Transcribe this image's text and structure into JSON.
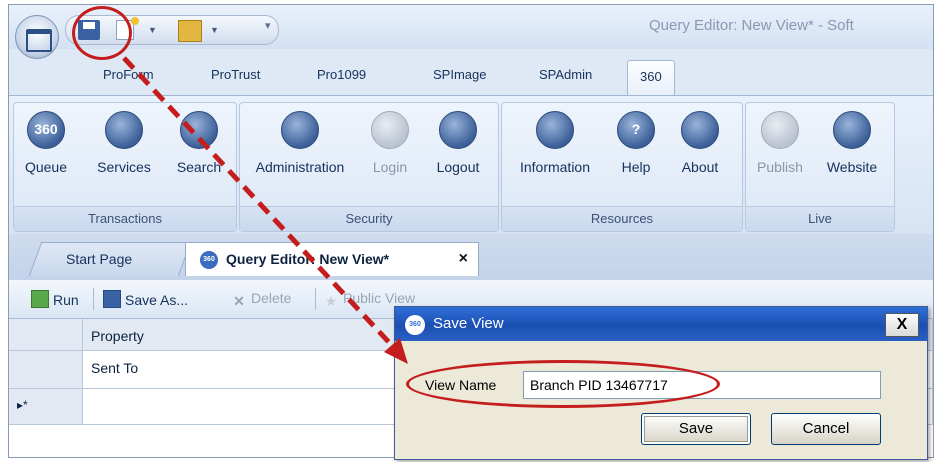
{
  "window": {
    "title": "Query Editor: New View* - Soft"
  },
  "quick_access": {
    "more": "▾"
  },
  "tabs": [
    {
      "label": "ProForm"
    },
    {
      "label": "ProTrust"
    },
    {
      "label": "Pro1099"
    },
    {
      "label": "SPImage"
    },
    {
      "label": "SPAdmin"
    },
    {
      "label": "360"
    }
  ],
  "ribbon": {
    "groups": [
      {
        "label": "Transactions",
        "buttons": [
          {
            "label": "Queue",
            "icon_text": "360"
          },
          {
            "label": "Services"
          },
          {
            "label": "Search"
          }
        ]
      },
      {
        "label": "Security",
        "buttons": [
          {
            "label": "Administration"
          },
          {
            "label": "Login"
          },
          {
            "label": "Logout"
          }
        ]
      },
      {
        "label": "Resources",
        "buttons": [
          {
            "label": "Information"
          },
          {
            "label": "Help",
            "icon_text": "?"
          },
          {
            "label": "About"
          }
        ]
      },
      {
        "label": "Live",
        "buttons": [
          {
            "label": "Publish"
          },
          {
            "label": "Website"
          }
        ]
      }
    ]
  },
  "doc_tabs": {
    "start": "Start Page",
    "query_editor": "Query Editor: New View*",
    "badge": "360",
    "close": "×"
  },
  "toolbar": {
    "run": "Run",
    "save_as": "Save As...",
    "delete": "Delete",
    "public_view": "Public View"
  },
  "grid": {
    "header": "Property",
    "rows": [
      "Sent To",
      ""
    ],
    "new_row_marker": "▸*"
  },
  "dialog": {
    "title": "Save View",
    "badge": "360",
    "close": "X",
    "label": "View Name",
    "value": "Branch PID 13467717",
    "save": "Save",
    "cancel": "Cancel"
  },
  "colors": {
    "annotation": "#c41d1d",
    "dialog_title": "#1b4fb2"
  }
}
